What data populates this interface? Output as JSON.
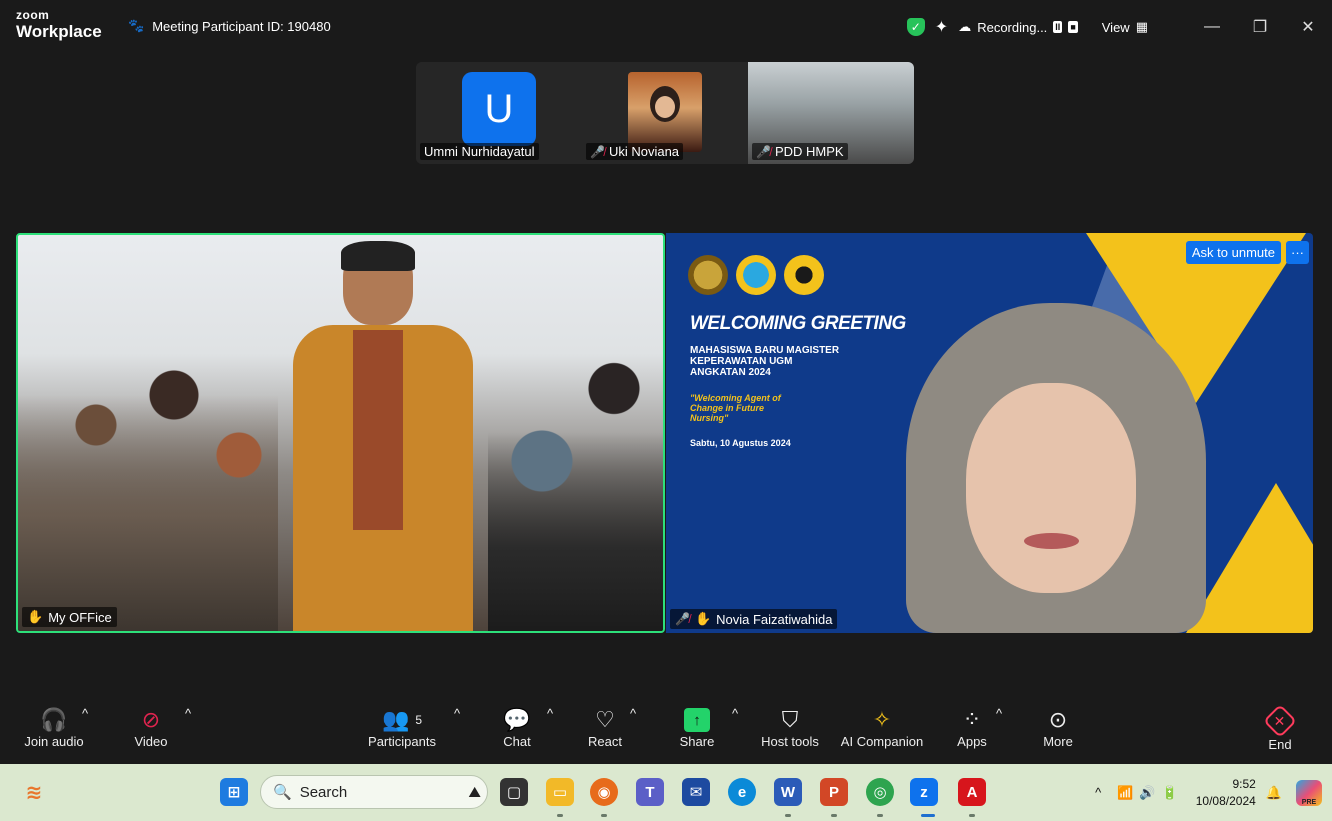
{
  "titlebar": {
    "logo_top": "zoom",
    "logo_bottom": "Workplace",
    "meeting_label": "Meeting Participant ID: 190480",
    "recording_label": "Recording...",
    "view_label": "View",
    "pause_glyph": "II",
    "stop_glyph": "■"
  },
  "thumbnails": [
    {
      "name": "Ummi Nurhidayatul",
      "avatar_letter": "U",
      "muted": false
    },
    {
      "name": "Uki Noviana",
      "muted": true
    },
    {
      "name": "PDD HMPK",
      "muted": true
    }
  ],
  "main": {
    "left_tile_name": "My OFFice",
    "right_tile_name": "Novia Faizatiwahida",
    "ask_to_unmute": "Ask to unmute",
    "more_options": "···",
    "slide": {
      "title": "WELCOMING GREETING",
      "subtitle_lines": [
        "MAHASISWA BARU MAGISTER",
        "KEPERAWATAN UGM",
        "ANGKATAN 2024"
      ],
      "quote": "\"Welcoming Agent of Change in Future Nursing\"",
      "date": "Sabtu, 10 Agustus 2024"
    }
  },
  "toolbar": {
    "join_audio": "Join audio",
    "video": "Video",
    "participants": "Participants",
    "participants_count": "5",
    "chat": "Chat",
    "react": "React",
    "share": "Share",
    "host_tools": "Host tools",
    "ai_companion": "AI Companion",
    "apps": "Apps",
    "more": "More",
    "end": "End"
  },
  "taskbar": {
    "search_label": "Search",
    "time": "9:52",
    "date": "10/08/2024",
    "pre_badge": "PRE"
  },
  "colors": {
    "accent_blue": "#0e72ed",
    "active_speaker_green": "#2de07a",
    "end_red": "#ff3b5c",
    "share_green": "#23d36a",
    "taskbar_bg": "#dbe8cf"
  }
}
